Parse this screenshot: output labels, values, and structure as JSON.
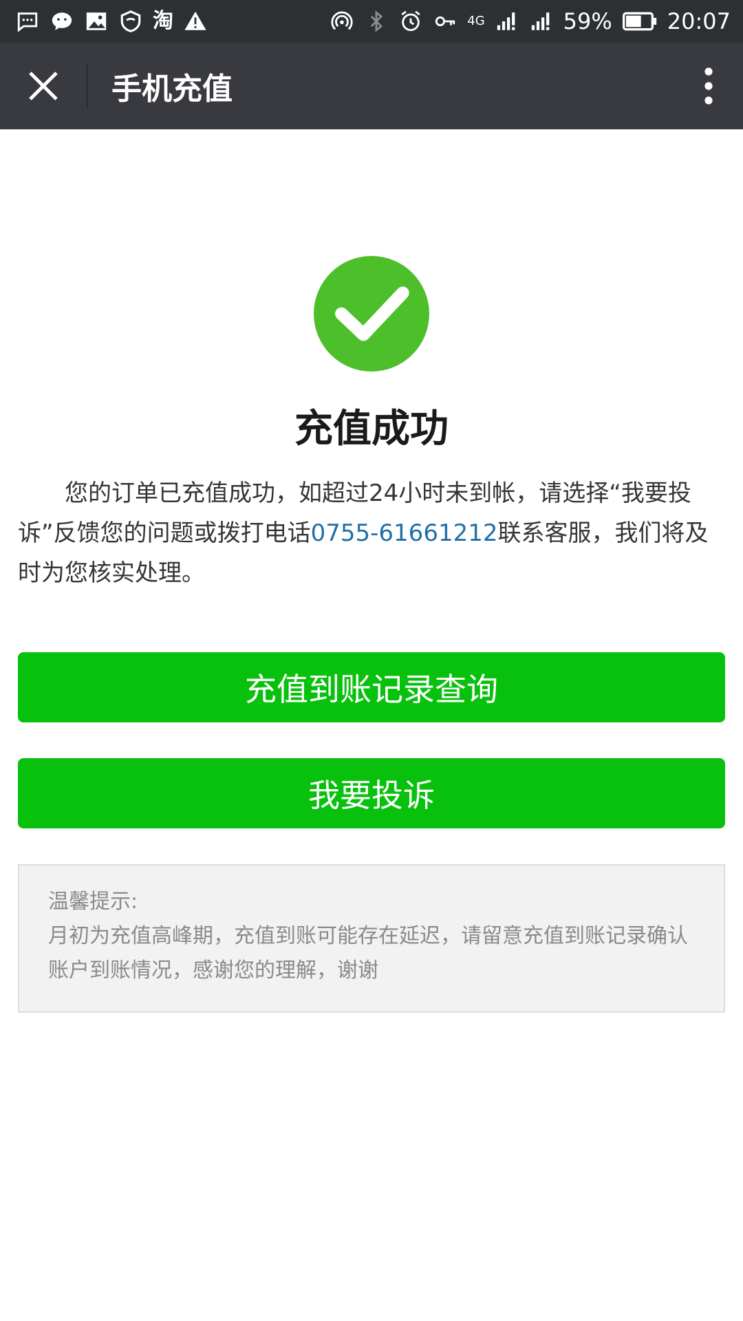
{
  "status_bar": {
    "battery": "59%",
    "time": "20:07",
    "network": "4G",
    "taobao_glyph": "淘",
    "icons_left": [
      "message-icon",
      "wechat-icon",
      "image-icon",
      "shield-icon",
      "taobao-icon",
      "warning-icon"
    ],
    "icons_right": [
      "hotspot-icon",
      "bluetooth-icon",
      "alarm-icon",
      "key-icon",
      "signal-4g-icon",
      "signal-icon",
      "battery-icon"
    ]
  },
  "header": {
    "title": "手机充值",
    "close_icon": "close-icon",
    "more_icon": "more-vertical-icon"
  },
  "result": {
    "icon": "checkmark-circle-icon",
    "title": "充值成功",
    "message_before": "您的订单已充值成功，如超过24小时未到帐，请选择“我要投诉”反馈您的问题或拨打电话",
    "phone": "0755-61661212",
    "message_after": "联系客服，我们将及时为您核实处理。"
  },
  "buttons": {
    "query_label": "充值到账记录查询",
    "complain_label": "我要投诉"
  },
  "tips": {
    "title": "温馨提示:",
    "body": "月初为充值高峰期，充值到账可能存在延迟，请留意充值到账记录确认账户到账情况，感谢您的理解，谢谢"
  },
  "colors": {
    "status_bar_bg": "#2d3033",
    "header_bg": "#393a3f",
    "success_green": "#4cbf2a",
    "button_green": "#07c10d",
    "link_blue": "#1f6fa8",
    "tips_bg": "#f2f2f2"
  }
}
